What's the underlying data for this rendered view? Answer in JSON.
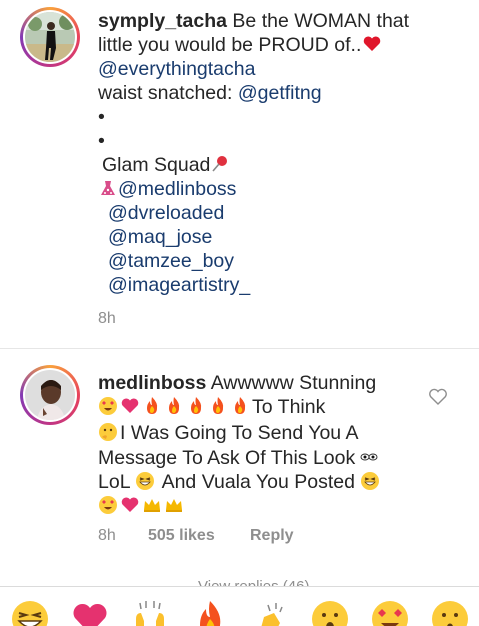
{
  "caption": {
    "username": "symply_tacha",
    "text": "Be the WOMAN that",
    "line2": "little you would be PROUD of..",
    "mention1": "@everythingtacha",
    "line4_prefix": "waist snatched: ",
    "mention2": "@getfitng",
    "dot": "•",
    "glam": "Glam Squad",
    "squad": [
      "@medlinboss",
      "@dvreloaded",
      "@maq_jose",
      "@tamzee_boy",
      "@imageartistry_"
    ],
    "time": "8h"
  },
  "comment": {
    "username": "medlinboss",
    "text1": "Awwwww Stunning",
    "text2": "To Think",
    "text3": "I Was Going To Send You A",
    "text4": "Message To Ask Of This Look",
    "text5a": "LoL",
    "text5b": "And Vuala You Posted",
    "time": "8h",
    "likes": "505 likes",
    "reply": "Reply"
  },
  "view_replies": "View replies (46)",
  "colors": {
    "mention": "#1a3c6e",
    "meta_gray": "#8e8e8e",
    "heart_red": "#e8384f"
  },
  "emoji_bar": [
    "grin-squint-icon",
    "heart-icon",
    "raising-hands-icon",
    "fire-icon",
    "clapping-hands-icon",
    "astonished-icon",
    "heart-eyes-icon",
    "hushed-icon"
  ]
}
